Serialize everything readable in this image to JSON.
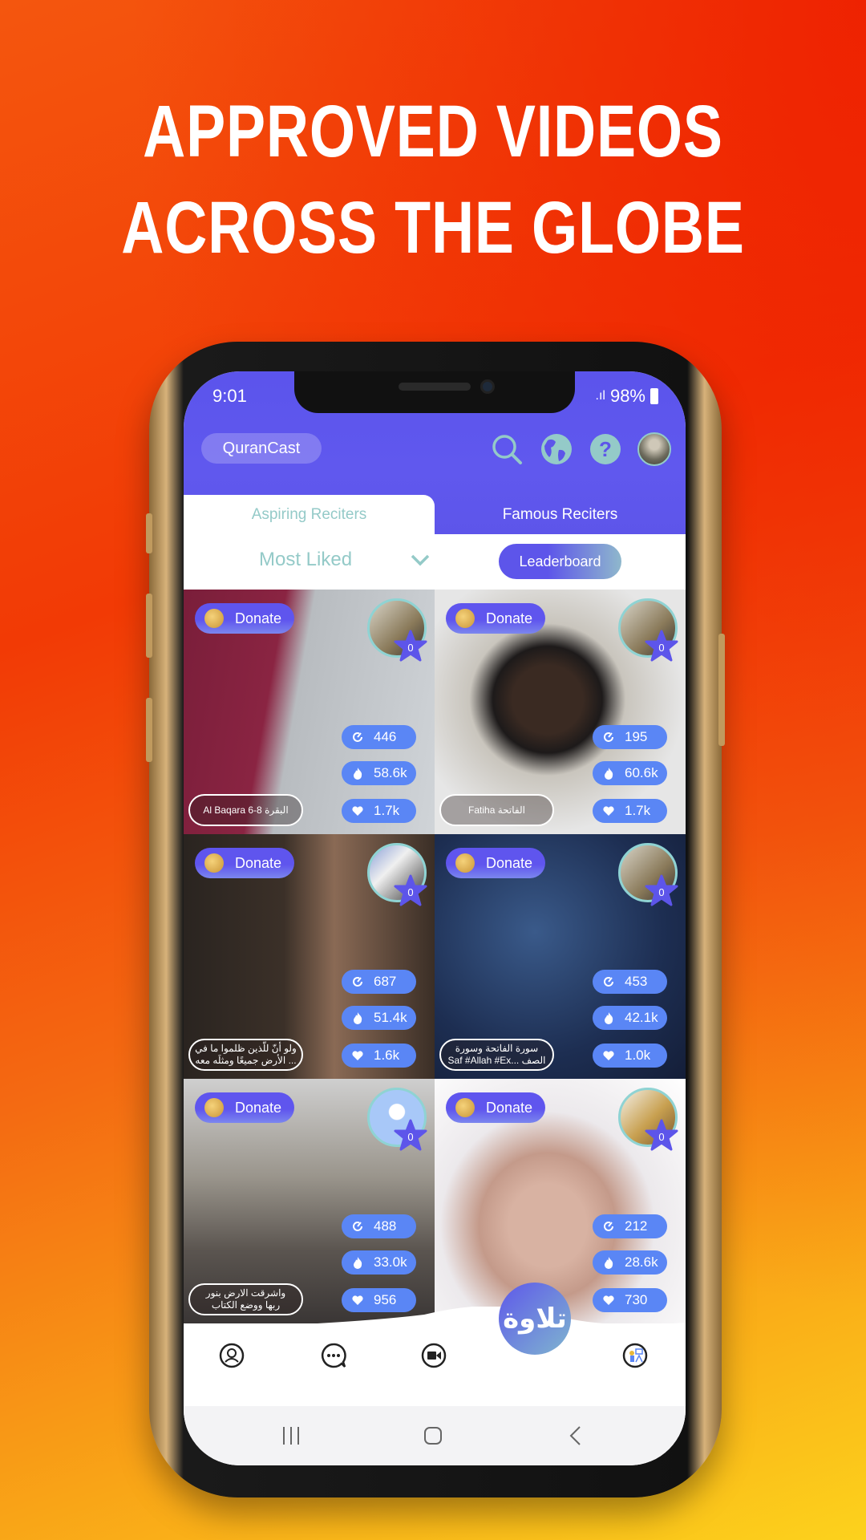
{
  "headline": {
    "line1": "APPROVED VIDEOS",
    "line2": "ACROSS THE GLOBE"
  },
  "status_bar": {
    "time": "9:01",
    "battery": "98%"
  },
  "header": {
    "app_name": "QuranCast",
    "icons": [
      "search-icon",
      "globe-icon",
      "help-icon",
      "profile-avatar"
    ]
  },
  "tabs": [
    {
      "label": "Aspiring Reciters",
      "active": true
    },
    {
      "label": "Famous Reciters",
      "active": false
    }
  ],
  "filter": {
    "sort_selected": "Most Liked",
    "leaderboard_label": "Leaderboard"
  },
  "colors": {
    "primary": "#5d55ea",
    "teal": "#94cac8",
    "stat_pill": "#5a86f5"
  },
  "videos": [
    {
      "donate": "Donate",
      "rank": "0",
      "views": "446",
      "fire": "58.6k",
      "likes": "1.7k",
      "caption": "Al Baqara 6-8 البقرة"
    },
    {
      "donate": "Donate",
      "rank": "0",
      "views": "195",
      "fire": "60.6k",
      "likes": "1.7k",
      "caption": "Fatiha الفاتحة"
    },
    {
      "donate": "Donate",
      "rank": "0",
      "views": "687",
      "fire": "51.4k",
      "likes": "1.6k",
      "caption": "ولو أنّ للّذين ظلموا ما في\nالأرض جميعًا ومثلَه معه ..."
    },
    {
      "donate": "Donate",
      "rank": "0",
      "views": "453",
      "fire": "42.1k",
      "likes": "1.0k",
      "caption": "سورة الفاتحة وسورة\nSaf #Allah #Ex... الصف"
    },
    {
      "donate": "Donate",
      "rank": "0",
      "views": "488",
      "fire": "33.0k",
      "likes": "956",
      "caption": "واشرقت الارض بنور\nربها ووضع الكتاب"
    },
    {
      "donate": "Donate",
      "rank": "0",
      "views": "212",
      "fire": "28.6k",
      "likes": "730",
      "caption": ""
    }
  ],
  "bottom_nav": {
    "logo_text": "تلاوة",
    "items": [
      "profile-icon",
      "chat-icon",
      "video-icon",
      "reciter-icon"
    ]
  }
}
